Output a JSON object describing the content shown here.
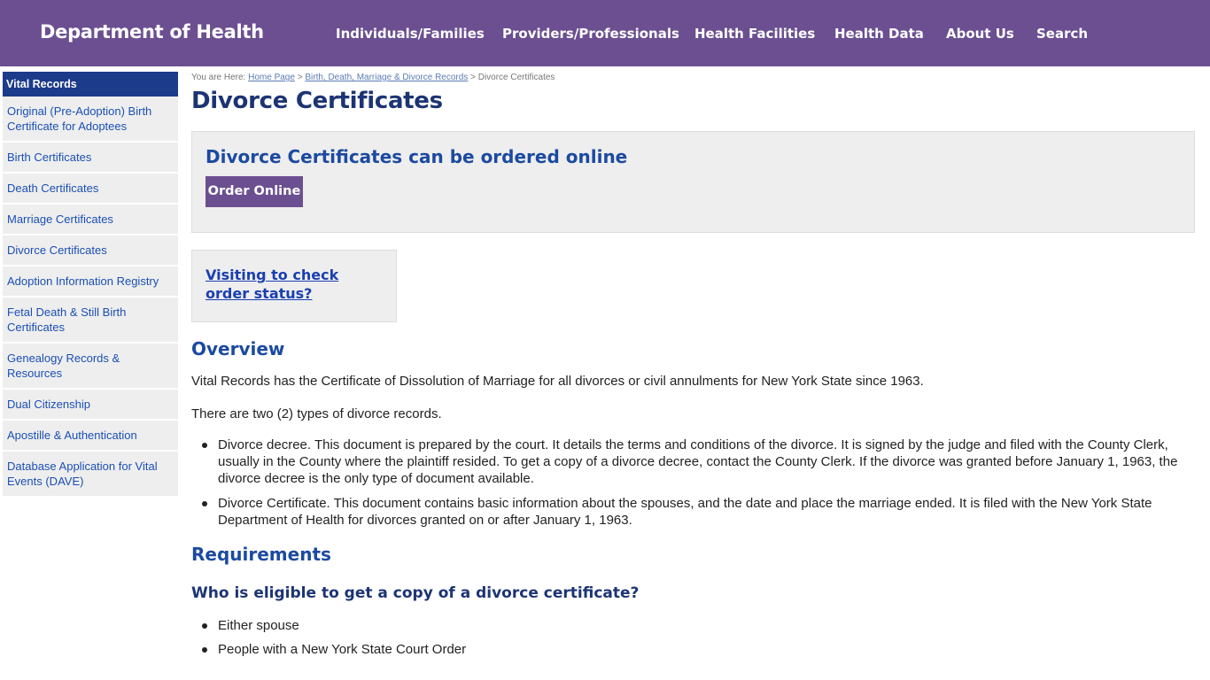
{
  "header": {
    "brand": "Department of Health",
    "nav": [
      "Individuals/Families",
      "Providers/Professionals",
      "Health Facilities",
      "Health Data",
      "About Us",
      "Search"
    ]
  },
  "sidebar": {
    "heading": "Vital Records",
    "items": [
      "Original (Pre-Adoption) Birth Certificate for Adoptees",
      "Birth Certificates",
      "Death Certificates",
      "Marriage Certificates",
      "Divorce Certificates",
      "Adoption Information Registry",
      "Fetal Death & Still Birth Certificates",
      "Genealogy Records & Resources",
      "Dual Citizenship",
      "Apostille & Authentication",
      "Database Application for Vital Events (DAVE)"
    ]
  },
  "breadcrumb": {
    "prefix": "You are Here:",
    "home": "Home Page",
    "sep": ">",
    "parent": "Birth, Death, Marriage & Divorce Records",
    "current": "Divorce Certificates"
  },
  "page": {
    "title": "Divorce Certificates",
    "order_heading": "Divorce Certificates can be ordered online",
    "order_button": "Order Online",
    "visit_link": "Visiting to check order status?",
    "overview_heading": "Overview",
    "overview_text": "Vital Records has the Certificate of Dissolution of Marriage for all divorces or civil annulments for New York State since 1963.",
    "types_text": "There are two (2) types of divorce records.",
    "types": [
      "Divorce decree. This document is prepared by the court. It details the terms and conditions of the divorce. It is signed by the judge and filed with the County Clerk, usually in the County where the plaintiff resided. To get a copy of a divorce decree, contact the County Clerk. If the divorce was granted before January 1, 1963, the divorce decree is the only type of document available.",
      "Divorce Certificate. This document contains basic information about the spouses, and the date and place the marriage ended. It is filed with the New York State Department of Health for divorces granted on or after January 1, 1963."
    ],
    "requirements_heading": "Requirements",
    "eligible_heading": "Who is eligible to get a copy of a divorce certificate?",
    "eligible": [
      "Either spouse",
      "People with a New York State Court Order"
    ]
  }
}
